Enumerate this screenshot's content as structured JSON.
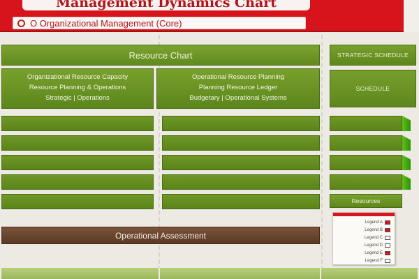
{
  "header": {
    "title": "Management Dynamics Chart",
    "subtitle": "O Organizational Management (Core)"
  },
  "grid": {
    "hero_label": "Resource Chart",
    "info_left": [
      "Organizational Resource Capacity",
      "Resource Planning & Operations",
      "Strategic | Operations"
    ],
    "info_right": [
      "Operational Resource Planning",
      "Planning Resource Ledger",
      "Budgetary | Operational Systems"
    ],
    "footer_label": "Operational Assessment"
  },
  "side": {
    "heading_top": "STRATEGIC SCHEDULE",
    "heading_mid": "SCHEDULE",
    "label": "Resources"
  },
  "legend": {
    "items": [
      {
        "label": "Legend A",
        "color": "#d7141b"
      },
      {
        "label": "Legend B",
        "color": "#d7141b"
      },
      {
        "label": "Legend C",
        "color": "#ffffff"
      },
      {
        "label": "Legend D",
        "color": "#ffffff"
      },
      {
        "label": "Legend E",
        "color": "#d7141b"
      },
      {
        "label": "Legend F",
        "color": "#ffffff"
      }
    ]
  },
  "colors": {
    "banner": "#d7141b",
    "grid_green": "#6f9728",
    "footer_brown": "#5a3a26",
    "tab_lime": "#4fb317"
  }
}
